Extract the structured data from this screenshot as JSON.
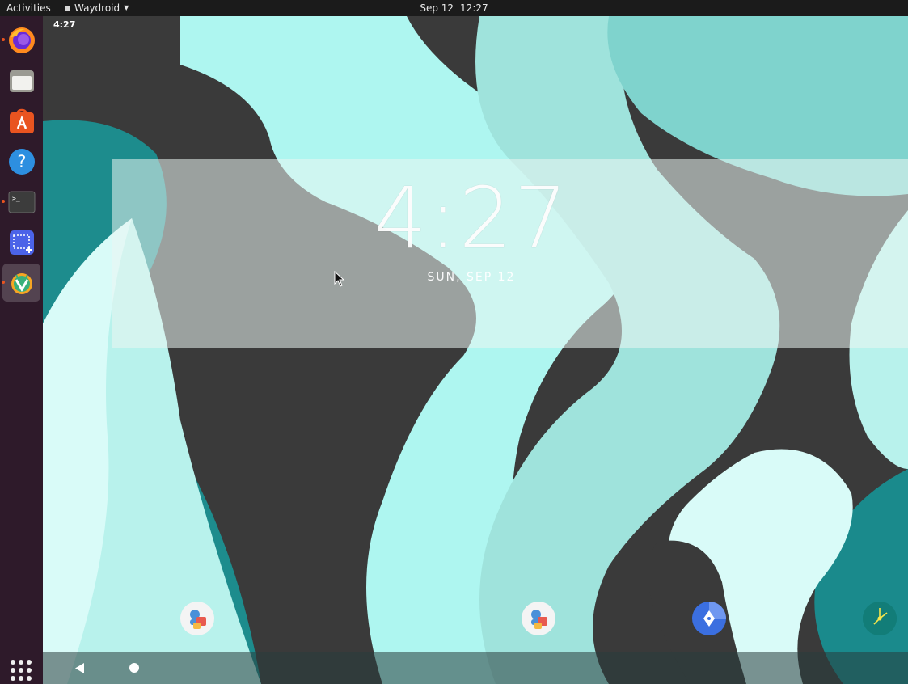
{
  "topbar": {
    "activities": "Activities",
    "app_name": "Waydroid",
    "date": "Sep 12",
    "time": "12:27"
  },
  "dock": {
    "items": [
      {
        "name": "firefox",
        "running": true
      },
      {
        "name": "files",
        "running": false
      },
      {
        "name": "software",
        "running": false
      },
      {
        "name": "help",
        "running": false
      },
      {
        "name": "terminal",
        "running": true
      },
      {
        "name": "screenshot",
        "running": false
      },
      {
        "name": "waydroid",
        "running": true,
        "active": true
      }
    ],
    "show_apps_icon": "grid-icon"
  },
  "android": {
    "status_time": "4:27",
    "clock_widget": {
      "time": "4:27",
      "date": "SUN, SEP 12"
    },
    "home_icons": [
      "contacts-icon",
      "contacts-icon",
      "maps-icon",
      "clock-icon"
    ],
    "colors": {
      "teal_light": "#b2f5ef",
      "teal": "#7fd3cd",
      "teal_dark": "#1c8a8a",
      "charcoal": "#3a3a3a"
    }
  }
}
